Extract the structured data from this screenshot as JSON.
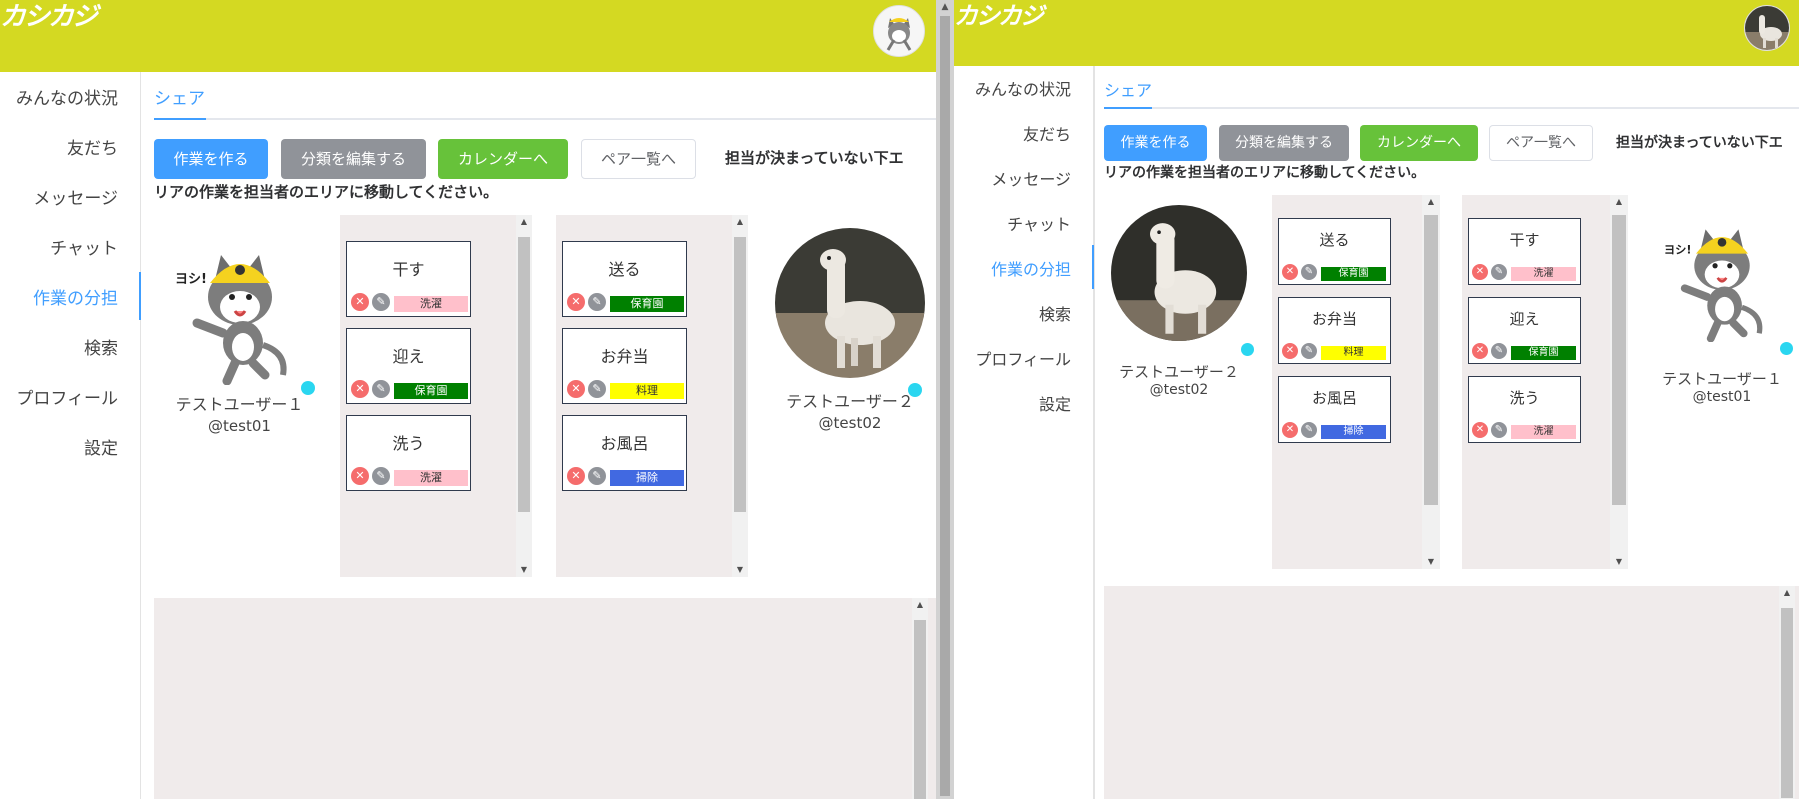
{
  "app": {
    "logo": "カシカジ"
  },
  "nav": [
    {
      "label": "みんなの状況"
    },
    {
      "label": "友だち"
    },
    {
      "label": "メッセージ"
    },
    {
      "label": "チャット"
    },
    {
      "label": "作業の分担"
    },
    {
      "label": "検索"
    },
    {
      "label": "プロフィール"
    },
    {
      "label": "設定"
    }
  ],
  "tab": {
    "label": "シェア"
  },
  "buttons": {
    "create": "作業を作る",
    "edit_category": "分類を編集する",
    "calendar": "カレンダーへ",
    "pairs": "ペア一覧へ"
  },
  "instruction": {
    "line1": "担当が決まっていない下エ",
    "line2": "リアの作業を担当者のエリアに移動してください。"
  },
  "users": {
    "user1": {
      "name": "テストユーザー１",
      "handle": "@test01",
      "avatar": "cat-worker-icon"
    },
    "user2": {
      "name": "テストユーザー２",
      "handle": "@test02",
      "avatar": "alpaca-photo"
    }
  },
  "colors": {
    "header": "#d4d922",
    "primary": "#409eff",
    "info": "#909399",
    "success": "#67c23a",
    "panel": "#f0ebeb",
    "online": "#2ad6f0",
    "tag_laundry": "#ffc0cb",
    "tag_nursery": "#008000",
    "tag_cooking": "#ffff00",
    "tag_cleaning": "#4169e1"
  },
  "left_view": {
    "column_user1": [
      {
        "title": "干す",
        "tag": "洗濯"
      },
      {
        "title": "迎え",
        "tag": "保育園"
      },
      {
        "title": "洗う",
        "tag": "洗濯"
      }
    ],
    "column_user2": [
      {
        "title": "送る",
        "tag": "保育園"
      },
      {
        "title": "お弁当",
        "tag": "料理"
      },
      {
        "title": "お風呂",
        "tag": "掃除"
      }
    ]
  },
  "right_view": {
    "column_user2": [
      {
        "title": "送る",
        "tag": "保育園"
      },
      {
        "title": "お弁当",
        "tag": "料理"
      },
      {
        "title": "お風呂",
        "tag": "掃除"
      }
    ],
    "column_user1": [
      {
        "title": "干す",
        "tag": "洗濯"
      },
      {
        "title": "迎え",
        "tag": "保育園"
      },
      {
        "title": "洗う",
        "tag": "洗濯"
      }
    ]
  }
}
